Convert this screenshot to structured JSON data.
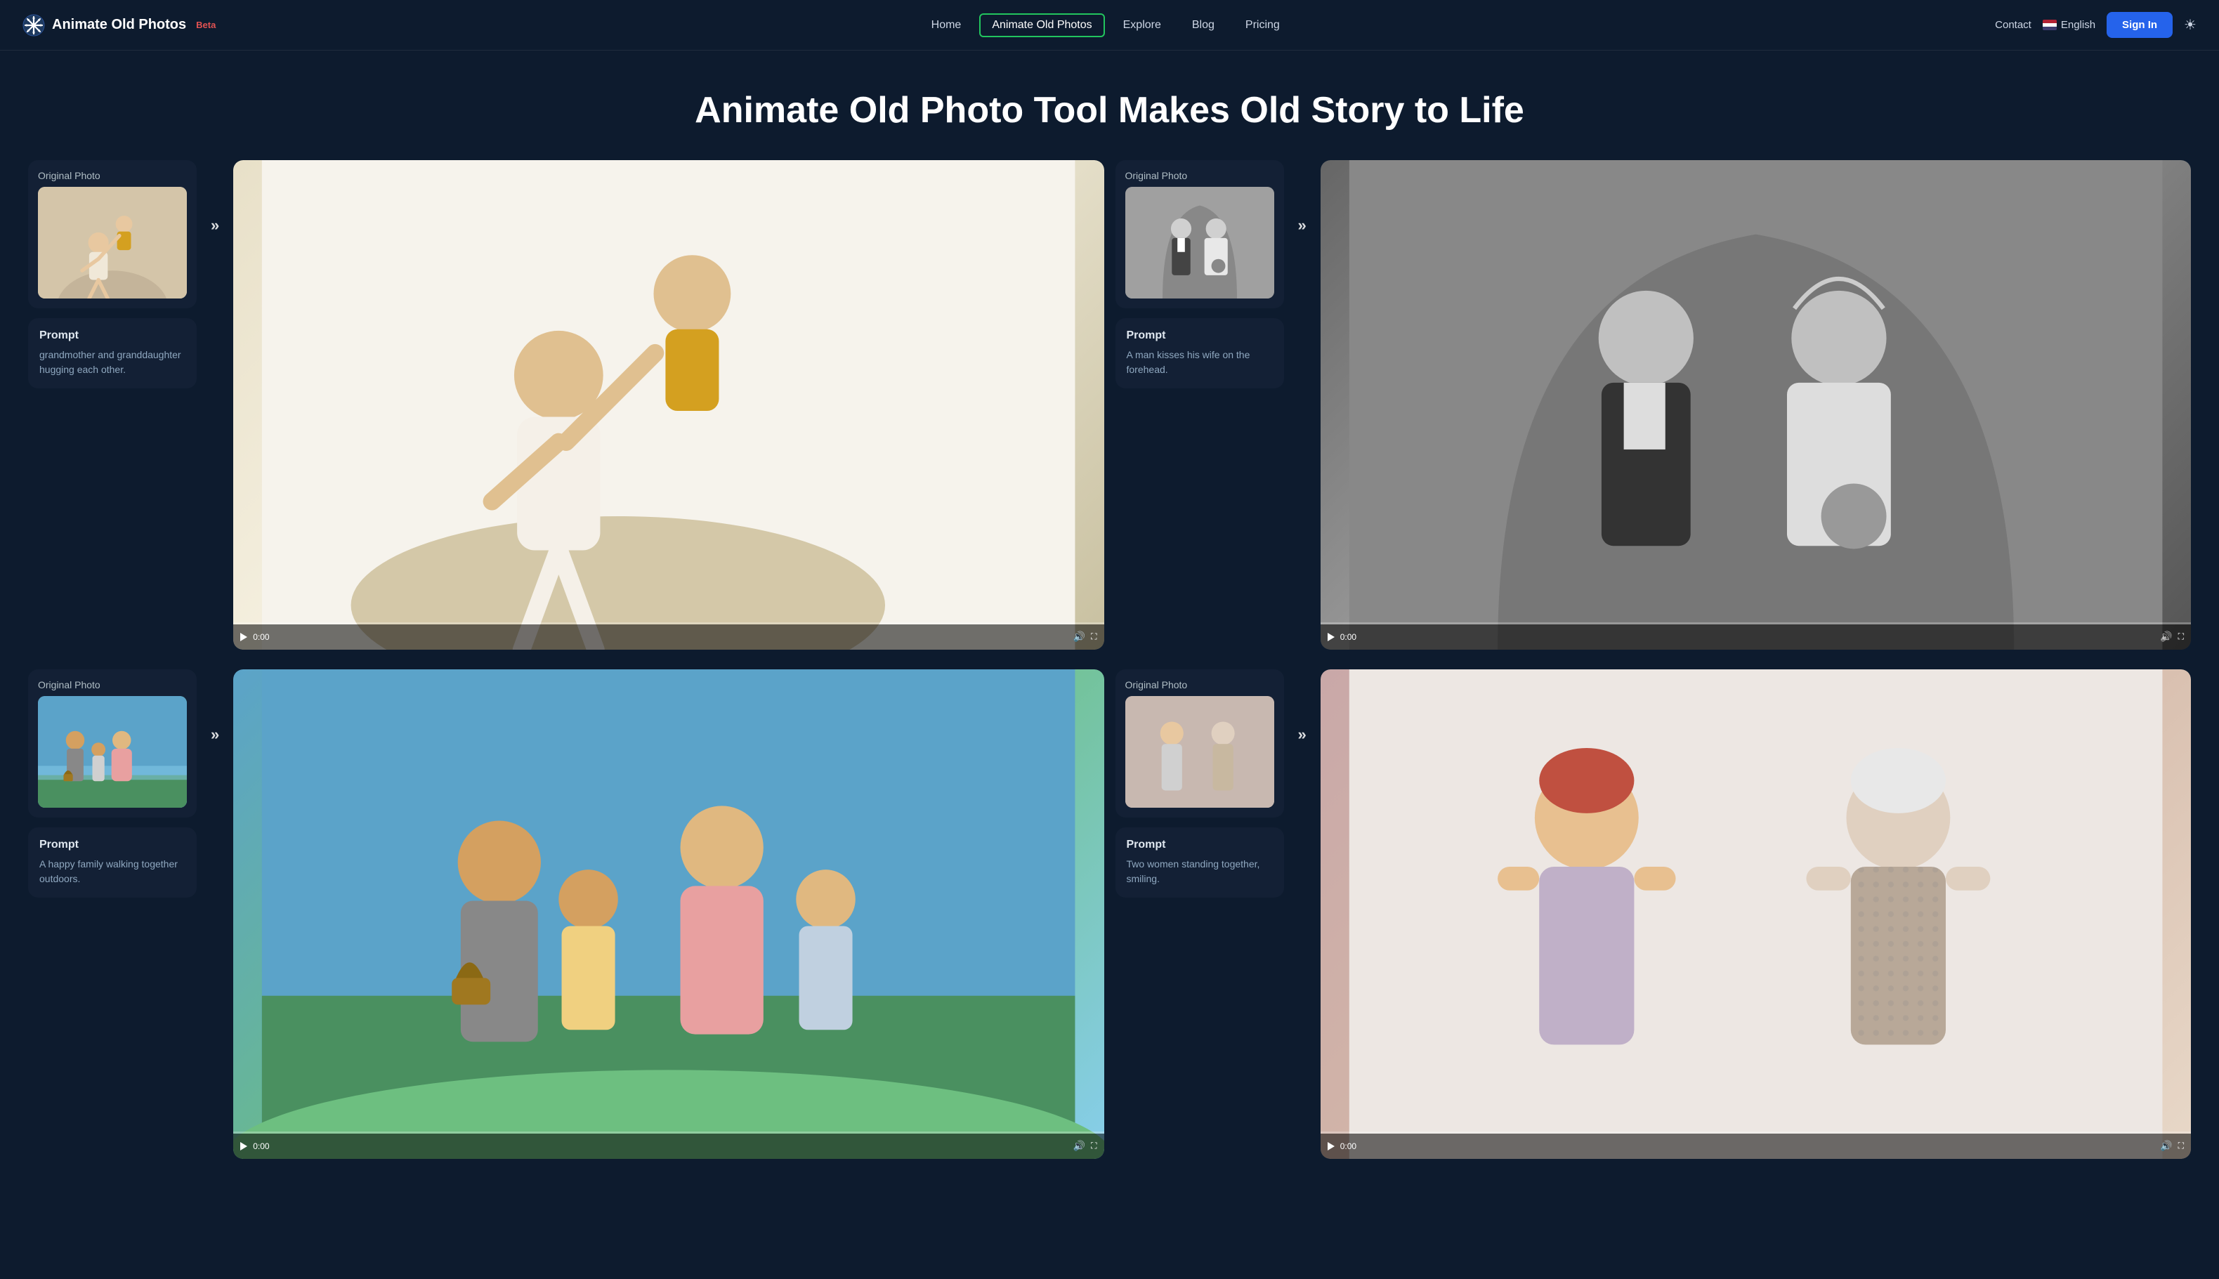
{
  "nav": {
    "logo_text": "Animate Old Photos",
    "logo_beta": "Beta",
    "links": [
      {
        "label": "Home",
        "active": false
      },
      {
        "label": "Animate Old Photos",
        "active": true
      },
      {
        "label": "Explore",
        "active": false
      },
      {
        "label": "Blog",
        "active": false
      },
      {
        "label": "Pricing",
        "active": false
      }
    ],
    "contact": "Contact",
    "language": "English",
    "sign_in": "Sign In"
  },
  "hero": {
    "title": "Animate Old Photo Tool Makes Old Story to Life"
  },
  "gallery": {
    "rows": [
      {
        "pair1": {
          "original_label": "Original Photo",
          "prompt_label": "Prompt",
          "prompt_text": "grandmother and granddaughter hugging each other.",
          "photo_type": "grandma"
        },
        "video1": {
          "time": "0:00",
          "type": "grandma"
        },
        "pair2": {
          "original_label": "Original Photo",
          "prompt_label": "Prompt",
          "prompt_text": "A man kisses his wife on the forehead.",
          "photo_type": "wedding"
        },
        "video2": {
          "time": "0:00",
          "type": "wedding"
        }
      },
      {
        "pair1": {
          "original_label": "Original Photo",
          "prompt_label": "Prompt",
          "prompt_text": "A happy family walking together outdoors.",
          "photo_type": "family"
        },
        "video1": {
          "time": "0:00",
          "type": "family"
        },
        "pair2": {
          "original_label": "Original Photo",
          "prompt_label": "Prompt",
          "prompt_text": "Two women standing together, smiling.",
          "photo_type": "women"
        },
        "video2": {
          "time": "0:00",
          "type": "women"
        }
      }
    ]
  },
  "colors": {
    "active_border": "#22c55e",
    "sign_in_bg": "#2563eb",
    "bg_dark": "#0d1b2e",
    "card_bg": "#132035"
  }
}
